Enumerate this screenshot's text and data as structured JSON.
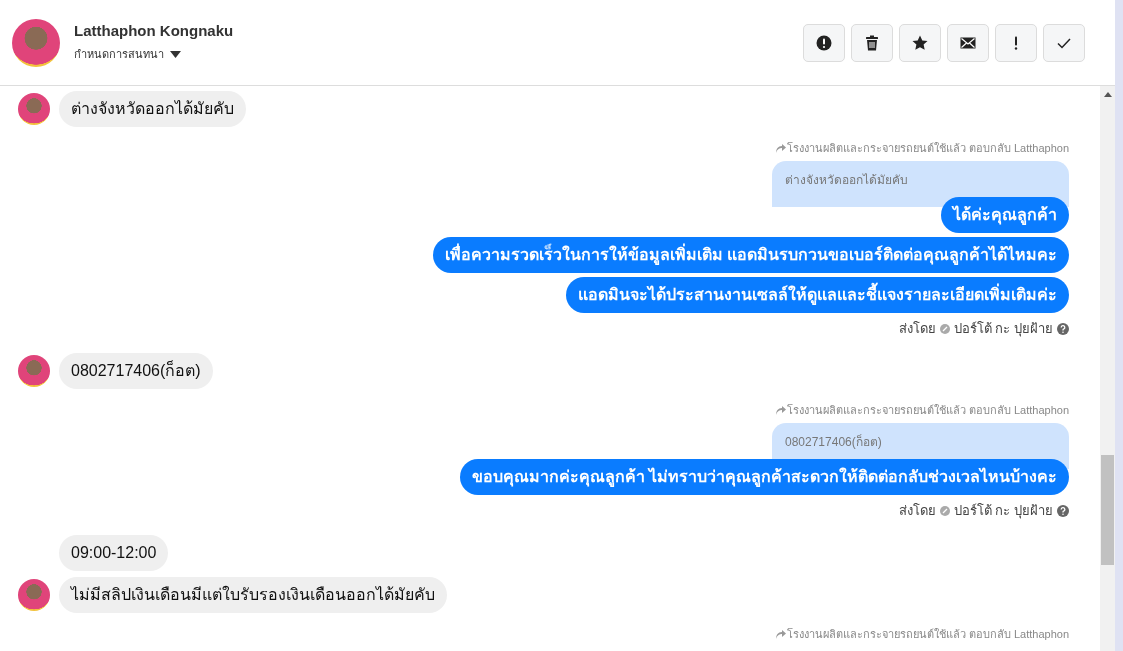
{
  "header": {
    "name": "Latthaphon Kongnaku",
    "subtitle": "กำหนดการสนทนา"
  },
  "toolbar": [
    {
      "kind": "alert"
    },
    {
      "kind": "trash"
    },
    {
      "kind": "star"
    },
    {
      "kind": "mail"
    },
    {
      "kind": "important"
    },
    {
      "kind": "done"
    }
  ],
  "messages": [
    {
      "kind": "incoming",
      "text": "ต่างจังหวัดออกได้มัยคับ",
      "avatar": true
    },
    {
      "kind": "reply_note",
      "text": "โรงงานผลิตและกระจายรถยนต์ใช้แล้ว ตอบกลับ Latthaphon"
    },
    {
      "kind": "quote",
      "text": "ต่างจังหวัดออกได้มัยคับ"
    },
    {
      "kind": "outgoing",
      "text": "ได้ค่ะคุณลูกค้า"
    },
    {
      "kind": "outgoing",
      "text": "เพื่อความรวดเร็วในการให้ข้อมูลเพิ่มเติม แอดมินรบกวนขอเบอร์ติดต่อคุณลูกค้าได้ไหมคะ"
    },
    {
      "kind": "outgoing",
      "text": "แอดมินจะได้ประสานงานเซลล์ให้ดูแลและชี้แจงรายละเอียดเพิ่มเติมค่ะ"
    },
    {
      "kind": "sent_by",
      "label": "ส่งโดย",
      "sender": "ปอร์โต้ กะ ปุยฝ้าย"
    },
    {
      "kind": "incoming",
      "text": "0802717406(ก็อต)",
      "avatar": true
    },
    {
      "kind": "reply_note",
      "text": "โรงงานผลิตและกระจายรถยนต์ใช้แล้ว ตอบกลับ Latthaphon"
    },
    {
      "kind": "quote",
      "text": "0802717406(ก็อต)"
    },
    {
      "kind": "outgoing",
      "text": "ขอบคุณมากค่ะคุณลูกค้า ไม่ทราบว่าคุณลูกค้าสะดวกให้ติดต่อกลับช่วงเวลไหนบ้างคะ"
    },
    {
      "kind": "sent_by",
      "label": "ส่งโดย",
      "sender": "ปอร์โต้ กะ ปุยฝ้าย"
    },
    {
      "kind": "incoming",
      "text": "09:00-12:00",
      "avatar": false
    },
    {
      "kind": "incoming",
      "text": "ไม่มีสลิปเงินเดือนมีแต่ใบรับรองเงินเดือนออกได้มัยคับ",
      "avatar": true
    },
    {
      "kind": "reply_note",
      "text": "โรงงานผลิตและกระจายรถยนต์ใช้แล้ว ตอบกลับ Latthaphon"
    }
  ]
}
